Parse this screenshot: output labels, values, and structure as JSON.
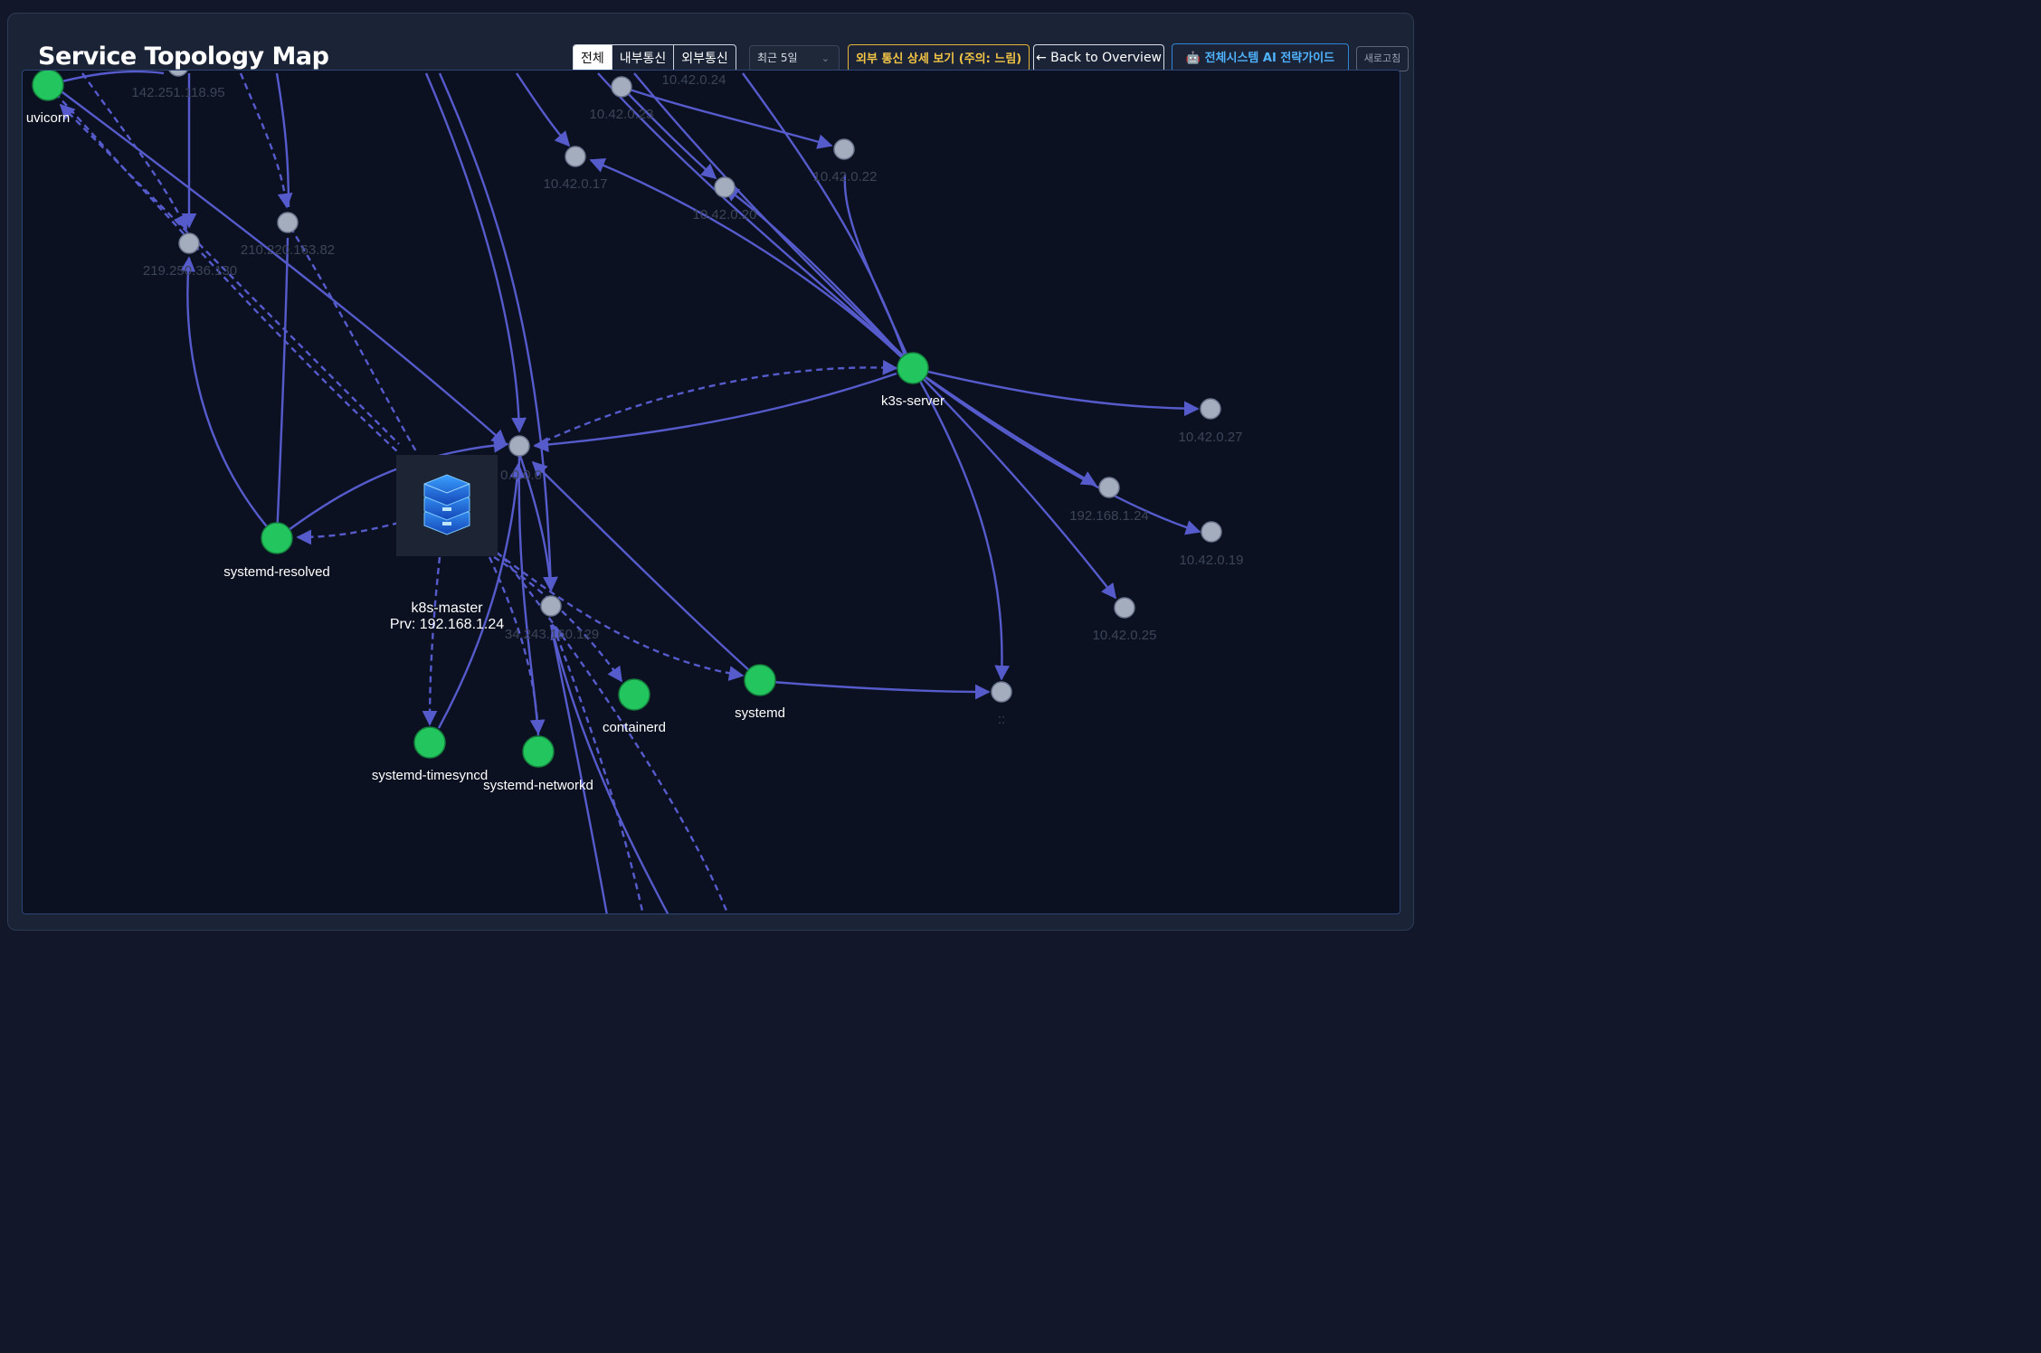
{
  "header": {
    "title": "Service Topology Map",
    "filters": [
      "전체",
      "내부통신",
      "외부통신"
    ],
    "time_range": "최근 5일",
    "external_detail_label": "외부 통신 상세 보기 (주의: 느림)",
    "back_label": "← Back to Overview",
    "ai_guide_label": "🤖 전체시스템 AI 전략가이드",
    "refresh_label": "새로고침"
  },
  "colors": {
    "edge": "#5b5fd6",
    "host_node": "#22c55e",
    "ip_node": "#a4adbd",
    "background": "#0b1120"
  },
  "nodes": [
    {
      "id": "uvicorn",
      "label": "uvicorn",
      "kind": "host"
    },
    {
      "id": "k3s-server",
      "label": "k3s-server",
      "kind": "host"
    },
    {
      "id": "systemd-resolved",
      "label": "systemd-resolved",
      "kind": "host"
    },
    {
      "id": "systemd-timesyncd",
      "label": "systemd-timesyncd",
      "kind": "host"
    },
    {
      "id": "systemd-networkd",
      "label": "systemd-networkd",
      "kind": "host"
    },
    {
      "id": "containerd",
      "label": "containerd",
      "kind": "host"
    },
    {
      "id": "systemd",
      "label": "systemd",
      "kind": "host"
    },
    {
      "id": "k8s-master",
      "label": "k8s-master",
      "sublabel": "Prv: 192.168.1.24",
      "kind": "server"
    },
    {
      "id": "ip-142",
      "label": "142.251.118.95",
      "kind": "ip"
    },
    {
      "id": "ip-21025",
      "label": "210.220.163.82",
      "kind": "ip"
    },
    {
      "id": "ip-219",
      "label": "219.250.36.130",
      "kind": "ip"
    },
    {
      "id": "ip-0000",
      "label": "0.0.0.0",
      "kind": "ip"
    },
    {
      "id": "ip-34",
      "label": "34.243.160.129",
      "kind": "ip"
    },
    {
      "id": "ip-1017",
      "label": "10.42.0.17",
      "kind": "ip"
    },
    {
      "id": "ip-1023",
      "label": "10.42.0.23",
      "kind": "ip"
    },
    {
      "id": "ip-1024",
      "label": "10.42.0.24",
      "kind": "ip"
    },
    {
      "id": "ip-1020",
      "label": "10.42.0.20",
      "kind": "ip"
    },
    {
      "id": "ip-1022",
      "label": "10.42.0.22",
      "kind": "ip"
    },
    {
      "id": "ip-1027",
      "label": "10.42.0.27",
      "kind": "ip"
    },
    {
      "id": "ip-19224",
      "label": "192.168.1.24",
      "kind": "ip"
    },
    {
      "id": "ip-1019",
      "label": "10.42.0.19",
      "kind": "ip"
    },
    {
      "id": "ip-1025",
      "label": "10.42.0.25",
      "kind": "ip"
    },
    {
      "id": "ip-v6",
      "label": "::",
      "kind": "ip"
    }
  ]
}
